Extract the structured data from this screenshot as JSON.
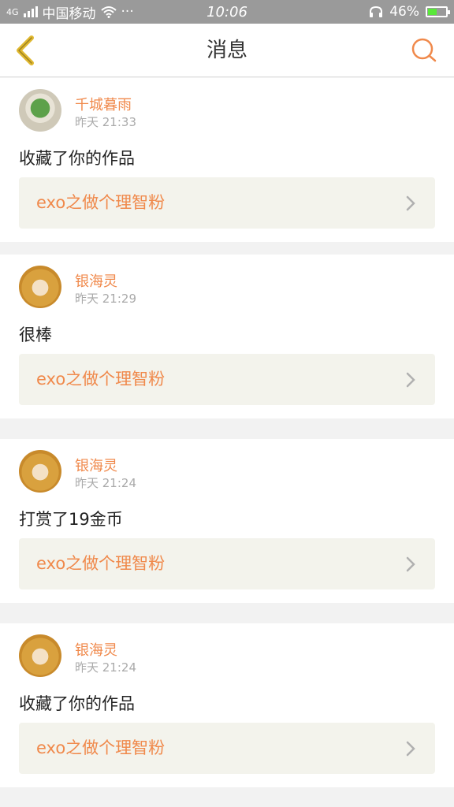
{
  "status_bar": {
    "network": "4G",
    "carrier": "中国移动",
    "more": "···",
    "time": "10:06",
    "battery_percent": "46%",
    "battery_level": 0.46,
    "icons": [
      "signal-icon",
      "wifi-icon",
      "headset-icon",
      "battery-icon"
    ]
  },
  "header": {
    "title": "消息",
    "back_icon": "chevron-left-icon",
    "search_icon": "search-icon"
  },
  "messages": [
    {
      "user": "千城暮雨",
      "time": "昨天 21:33",
      "text": "收藏了你的作品",
      "link": "exo之做个理智粉"
    },
    {
      "user": "银海灵",
      "time": "昨天 21:29",
      "text": "很棒",
      "link": "exo之做个理智粉"
    },
    {
      "user": "银海灵",
      "time": "昨天 21:24",
      "text": "打赏了19金币",
      "link": "exo之做个理智粉"
    },
    {
      "user": "银海灵",
      "time": "昨天 21:24",
      "text": "收藏了你的作品",
      "link": "exo之做个理智粉"
    }
  ],
  "colors": {
    "accent": "#f0894b",
    "back_icon": "#e0b830",
    "link_bg": "#f3f3ec"
  }
}
